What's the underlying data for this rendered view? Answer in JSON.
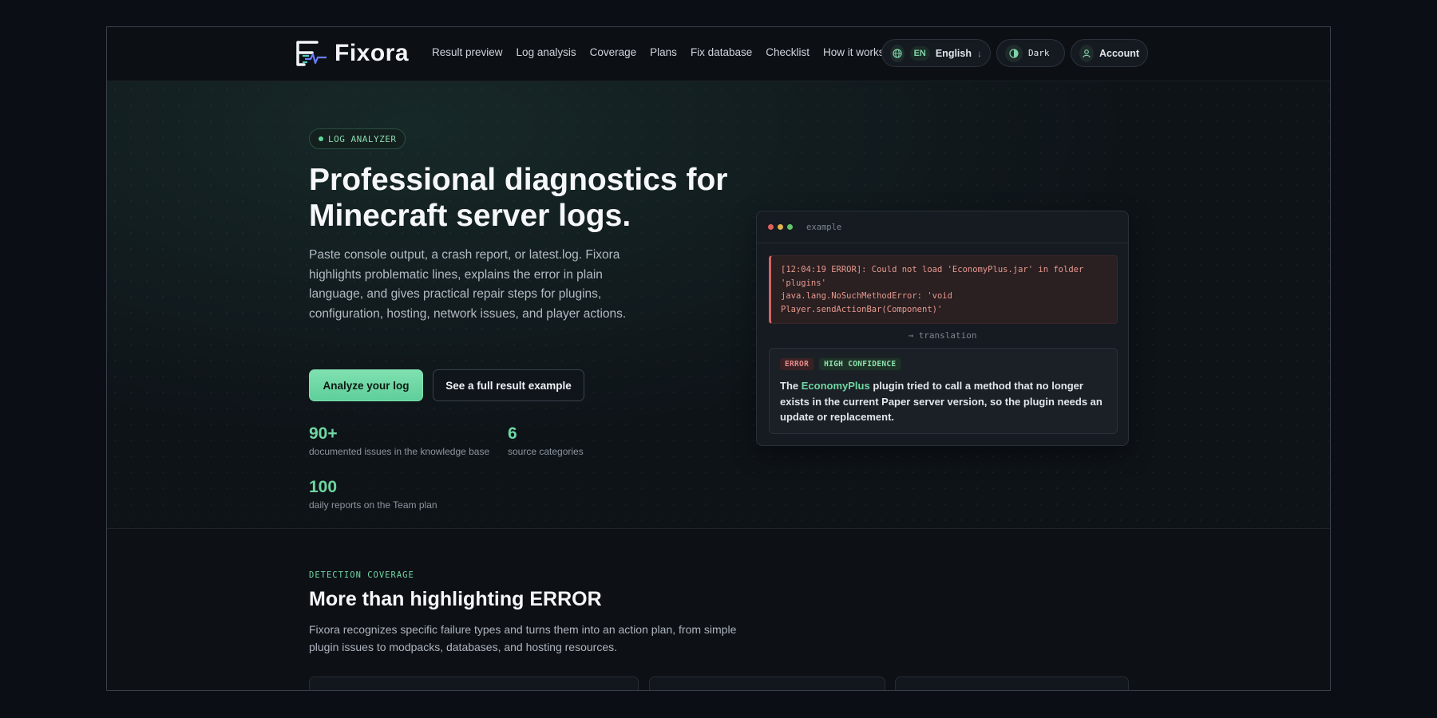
{
  "brand": {
    "name": "Fixora"
  },
  "nav": {
    "links": [
      "Result preview",
      "Log analysis",
      "Coverage",
      "Plans",
      "Fix database",
      "Checklist",
      "How it works"
    ],
    "language": {
      "code": "EN",
      "label": "English",
      "icon": "globe-icon"
    },
    "theme": {
      "label": "Dark",
      "icon": "contrast-icon"
    },
    "account": {
      "label": "Account",
      "icon": "user-icon"
    }
  },
  "hero": {
    "badge": "LOG ANALYZER",
    "title": "Professional diagnostics for Minecraft server logs.",
    "description": "Paste console output, a crash report, or latest.log. Fixora highlights problematic lines, explains the error in plain language, and gives practical repair steps for plugins, configuration, hosting, network issues, and player actions.",
    "primary_button": "Analyze your log",
    "secondary_button": "See a full result example",
    "stats": [
      {
        "value": "90+",
        "label": "documented issues in the knowledge base"
      },
      {
        "value": "6",
        "label": "source categories"
      },
      {
        "value": "100",
        "label": "daily reports on the Team plan"
      }
    ]
  },
  "example": {
    "title": "example",
    "log_lines": [
      "[12:04:19 ERROR]: Could not load 'EconomyPlus.jar' in folder",
      "'plugins'",
      "java.lang.NoSuchMethodError: 'void",
      "Player.sendActionBar(Component)'"
    ],
    "translation_label": "translation",
    "tags": {
      "severity": "ERROR",
      "confidence": "HIGH CONFIDENCE"
    },
    "explanation": {
      "before": "The ",
      "plugin": "EconomyPlus",
      "after": " plugin tried to call a method that no longer exists in the current Paper server version, so the plugin needs an update or replacement."
    }
  },
  "coverage": {
    "kicker": "DETECTION COVERAGE",
    "title": "More than highlighting ERROR",
    "description": "Fixora recognizes specific failure types and turns them into an action plan, from simple plugin issues to modpacks, databases, and hosting resources."
  },
  "colors": {
    "accent": "#6fd6a2",
    "background": "#0b0f15",
    "error": "#e59a8f",
    "dot_red": "#e0605a",
    "dot_yellow": "#e0b24a",
    "dot_green": "#5fc76a"
  }
}
